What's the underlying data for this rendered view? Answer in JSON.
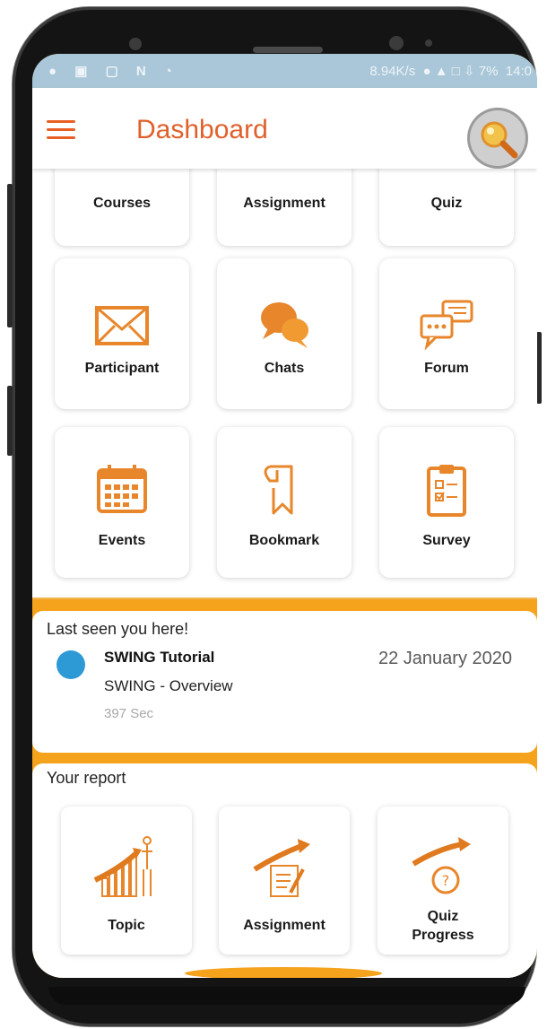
{
  "status_bar": {
    "icons": "● ▣ ▢ N ◔",
    "speed": "8.94K/s",
    "battery": "7%",
    "time": "14:0"
  },
  "app_bar": {
    "title": "Dashboard",
    "menu_icon": "hamburger-icon",
    "search_icon": "magnifier-icon"
  },
  "tiles": [
    {
      "label": "Courses",
      "icon": "courses-icon"
    },
    {
      "label": "Assignment",
      "icon": "assignment-icon"
    },
    {
      "label": "Quiz",
      "icon": "quiz-icon"
    },
    {
      "label": "Participant",
      "icon": "envelope-icon"
    },
    {
      "label": "Chats",
      "icon": "chat-bubbles-icon"
    },
    {
      "label": "Forum",
      "icon": "forum-icon"
    },
    {
      "label": "Events",
      "icon": "calendar-icon"
    },
    {
      "label": "Bookmark",
      "icon": "bookmark-icon"
    },
    {
      "label": "Survey",
      "icon": "clipboard-icon"
    }
  ],
  "last_seen": {
    "heading": "Last seen you here!",
    "course": "SWING Tutorial",
    "lesson": "SWING - Overview",
    "duration": "397 Sec",
    "date": "22 January 2020"
  },
  "report": {
    "heading": "Your report",
    "items": [
      {
        "label": "Topic",
        "icon": "topic-growth-icon"
      },
      {
        "label": "Assignment",
        "icon": "assignment-progress-icon"
      },
      {
        "label": "Quiz Progress",
        "icon": "quiz-progress-icon"
      }
    ]
  },
  "colors": {
    "accent": "#e0602b",
    "orange": "#f5a21d",
    "dot": "#2d9ad6"
  }
}
